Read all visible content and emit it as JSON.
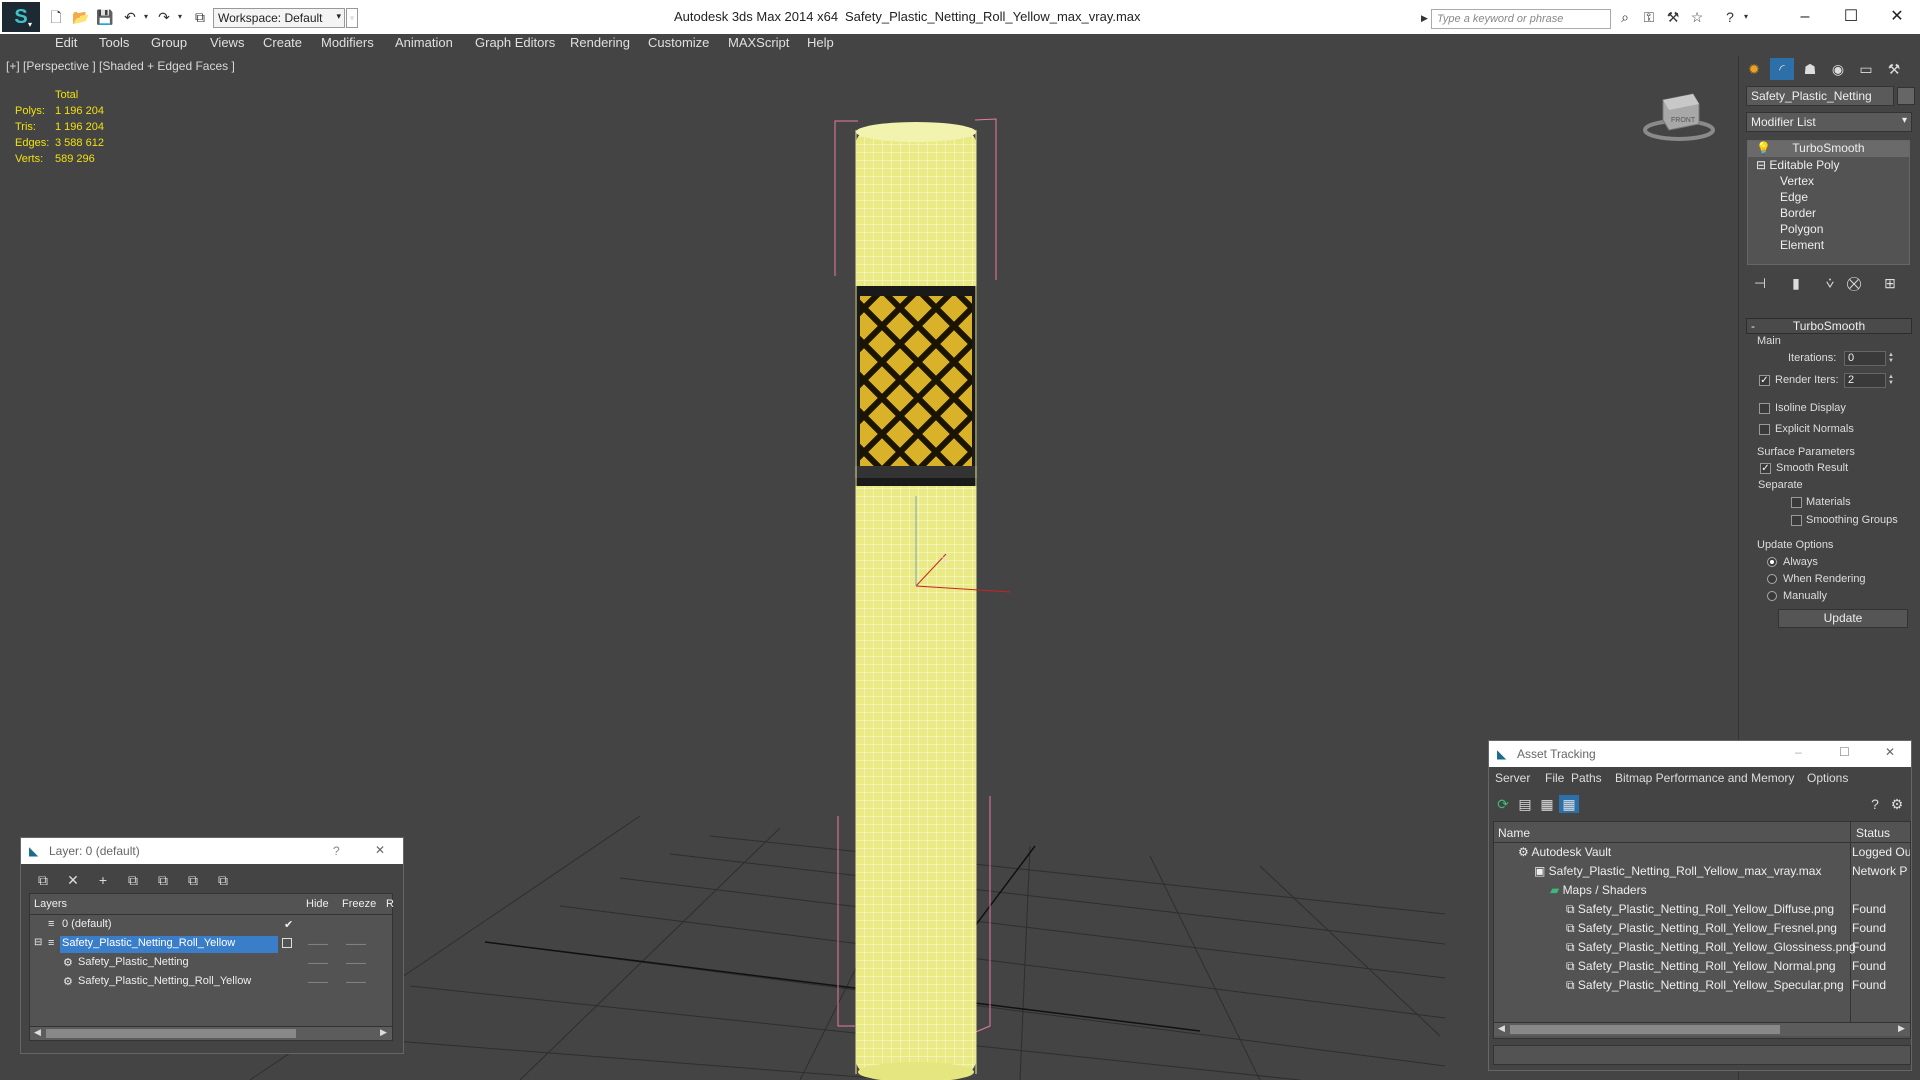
{
  "titlebar": {
    "workspace": "Workspace: Default",
    "app_title": "Autodesk 3ds Max  2014 x64",
    "doc_title": "Safety_Plastic_Netting_Roll_Yellow_max_vray.max",
    "search_placeholder": "Type a keyword or phrase",
    "window_buttons": [
      "–",
      "☐",
      "✕"
    ]
  },
  "menu": [
    "Edit",
    "Tools",
    "Group",
    "Views",
    "Create",
    "Modifiers",
    "Animation",
    "Graph Editors",
    "Rendering",
    "Customize",
    "MAXScript",
    "Help"
  ],
  "viewport": {
    "label": "[+] [Perspective ] [Shaded + Edged Faces ]",
    "stats_header": "Total",
    "stats": [
      {
        "label": "Polys:",
        "value": "1 196 204"
      },
      {
        "label": "Tris:",
        "value": "1 196 204"
      },
      {
        "label": "Edges:",
        "value": "3 588 612"
      },
      {
        "label": "Verts:",
        "value": "589 296"
      }
    ],
    "viewcube_label": "FRONT"
  },
  "command_panel": {
    "object_name": "Safety_Plastic_Netting",
    "modifier_list": "Modifier List",
    "stack": [
      "TurboSmooth",
      "Editable Poly",
      "Vertex",
      "Edge",
      "Border",
      "Polygon",
      "Element"
    ],
    "turbosmooth": {
      "title": "TurboSmooth",
      "main": "Main",
      "iterations_label": "Iterations:",
      "iterations_value": "0",
      "render_iters_label": "Render Iters:",
      "render_iters_value": "2",
      "isoline": "Isoline Display",
      "explicit_normals": "Explicit Normals",
      "surface_params": "Surface Parameters",
      "smooth_result": "Smooth Result",
      "separate": "Separate",
      "materials": "Materials",
      "smoothing_groups": "Smoothing Groups",
      "update_options": "Update Options",
      "always": "Always",
      "when_rendering": "When Rendering",
      "manually": "Manually",
      "update_btn": "Update"
    }
  },
  "layer_dialog": {
    "title": "Layer: 0 (default)",
    "help": "?",
    "close": "✕",
    "columns": [
      "Layers",
      "Hide",
      "Freeze",
      "R"
    ],
    "rows": [
      {
        "name": "0 (default)",
        "active": true
      },
      {
        "name": "Safety_Plastic_Netting_Roll_Yellow",
        "selected": true
      },
      {
        "name": "Safety_Plastic_Netting"
      },
      {
        "name": "Safety_Plastic_Netting_Roll_Yellow"
      }
    ],
    "dash": "——"
  },
  "asset_tracking": {
    "title": "Asset Tracking",
    "menu": [
      "Server",
      "File",
      "Paths",
      "Bitmap Performance and Memory",
      "Options"
    ],
    "columns": [
      "Name",
      "Status"
    ],
    "rows": [
      {
        "name": "Autodesk Vault",
        "status": "Logged Ou"
      },
      {
        "name": "Safety_Plastic_Netting_Roll_Yellow_max_vray.max",
        "status": "Network P"
      },
      {
        "name": "Maps / Shaders",
        "status": ""
      },
      {
        "name": "Safety_Plastic_Netting_Roll_Yellow_Diffuse.png",
        "status": "Found"
      },
      {
        "name": "Safety_Plastic_Netting_Roll_Yellow_Fresnel.png",
        "status": "Found"
      },
      {
        "name": "Safety_Plastic_Netting_Roll_Yellow_Glossiness.png",
        "status": "Found"
      },
      {
        "name": "Safety_Plastic_Netting_Roll_Yellow_Normal.png",
        "status": "Found"
      },
      {
        "name": "Safety_Plastic_Netting_Roll_Yellow_Specular.png",
        "status": "Found"
      }
    ]
  }
}
